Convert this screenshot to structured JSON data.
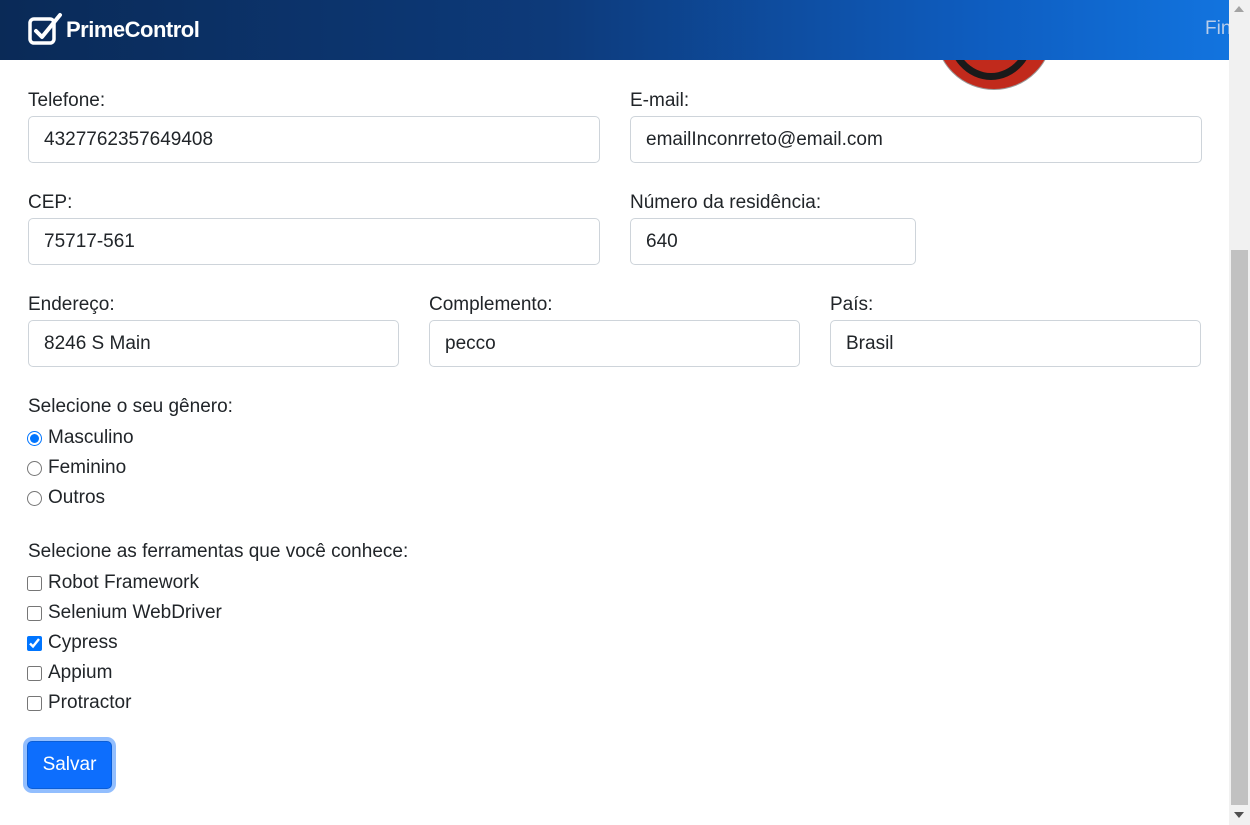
{
  "header": {
    "brand": "PrimeControl",
    "brand_icon": "check-square-icon",
    "nav_link": "Fin",
    "gradient_start": "#0a2a57",
    "gradient_end": "#1274df"
  },
  "avatar": {
    "icon": "avatar-image",
    "color": "#c12a1c"
  },
  "form": {
    "telefone": {
      "label": "Telefone:",
      "value": "4327762357649408"
    },
    "email": {
      "label": "E-mail:",
      "value": "emailInconrreto@email.com"
    },
    "cep": {
      "label": "CEP:",
      "value": "75717-561"
    },
    "numero": {
      "label": "Número da residência:",
      "value": "640"
    },
    "endereco": {
      "label": "Endereço:",
      "value": "8246 S Main"
    },
    "complemento": {
      "label": "Complemento:",
      "value": "pecco"
    },
    "pais": {
      "label": "País:",
      "value": "Brasil"
    },
    "gender": {
      "label": "Selecione o seu gênero:",
      "options": [
        "Masculino",
        "Feminino",
        "Outros"
      ],
      "selected": "Masculino"
    },
    "tools": {
      "label": "Selecione as ferramentas que você conhece:",
      "options": [
        "Robot Framework",
        "Selenium WebDriver",
        "Cypress",
        "Appium",
        "Protractor"
      ],
      "checked": [
        "Cypress"
      ]
    },
    "save_label": "Salvar",
    "accent": "#0d6efd"
  }
}
